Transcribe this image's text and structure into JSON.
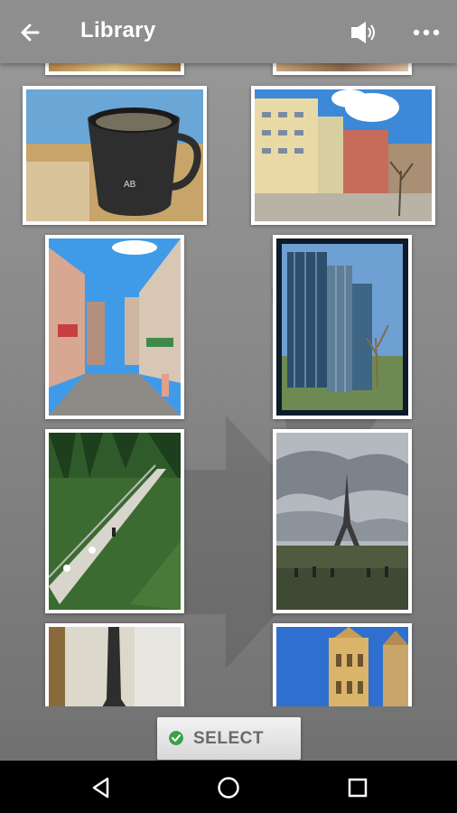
{
  "appbar": {
    "title": "Library",
    "icons": {
      "back": "arrow-left-icon",
      "sound": "speaker-icon",
      "more": "more-horizontal-icon"
    }
  },
  "photos": [
    {
      "name": "photo-coffee-cup",
      "description_icon": "image-icon"
    },
    {
      "name": "photo-city-buildings",
      "description_icon": "image-icon"
    },
    {
      "name": "photo-street",
      "description_icon": "image-icon"
    },
    {
      "name": "photo-tower-building",
      "description_icon": "image-icon"
    },
    {
      "name": "photo-suspension-bridge",
      "description_icon": "image-icon"
    },
    {
      "name": "photo-eiffel-tower",
      "description_icon": "image-icon"
    },
    {
      "name": "photo-wall-pipe",
      "description_icon": "image-icon"
    },
    {
      "name": "photo-belfry-tower",
      "description_icon": "image-icon"
    }
  ],
  "select_button": {
    "label": "SELECT",
    "icon": "check-circle-icon"
  },
  "navbar": {
    "icons": [
      "back-triangle-icon",
      "home-circle-icon",
      "recents-square-icon"
    ]
  },
  "colors": {
    "appbar": "#8e8e8e",
    "accent_green": "#3aa14b",
    "navbar": "#000000"
  }
}
